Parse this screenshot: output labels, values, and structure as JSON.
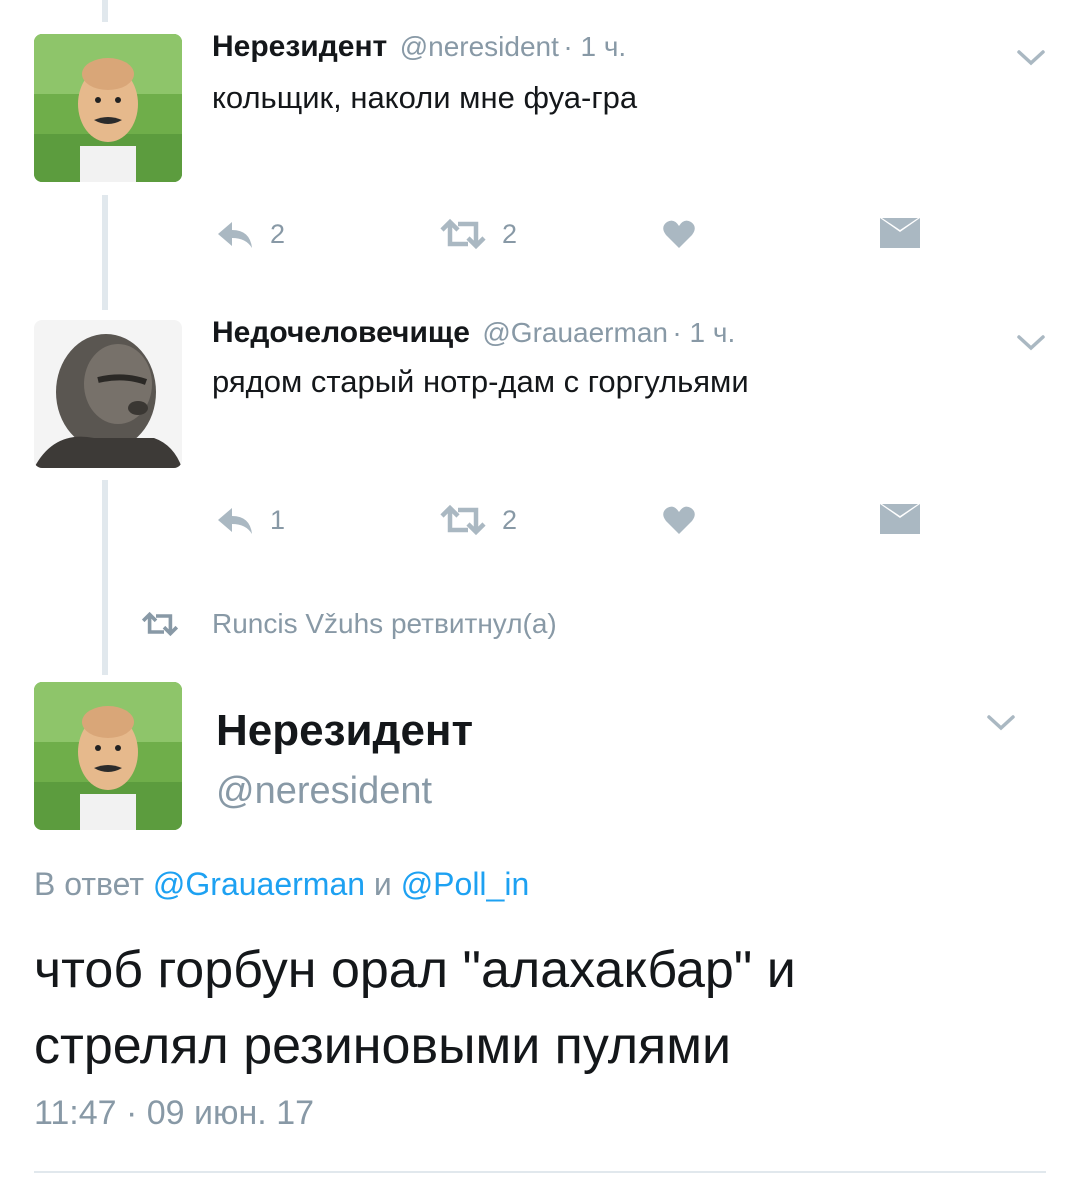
{
  "tweets": [
    {
      "name": "Нерезидент",
      "handle": "@neresident",
      "time": "1 ч.",
      "text": "кольщик, наколи мне фуа-гра",
      "reply_count": "2",
      "retweet_count": "2"
    },
    {
      "name": "Недочеловечище",
      "handle": "@Grauaerman",
      "time": "1 ч.",
      "text": "рядом старый нотр-дам с горгульями",
      "reply_count": "1",
      "retweet_count": "2"
    }
  ],
  "retweet_context": "Runcis Vžuhs ретвитнул(а)",
  "main": {
    "name": "Нерезидент",
    "handle": "@neresident",
    "reply_prefix": "В ответ",
    "reply_user1": "@Grauaerman",
    "reply_and": "и",
    "reply_user2": "@Poll_in",
    "text_line1": "чтоб горбун орал \"алахакбар\" и",
    "text_line2": "стрелял резиновыми пулями",
    "timestamp": "11:47 · 09 июн. 17"
  },
  "colors": {
    "icon": "#aab8c2",
    "meta": "#8899a6",
    "link": "#1da1f2",
    "thread": "#e1e8ed"
  }
}
